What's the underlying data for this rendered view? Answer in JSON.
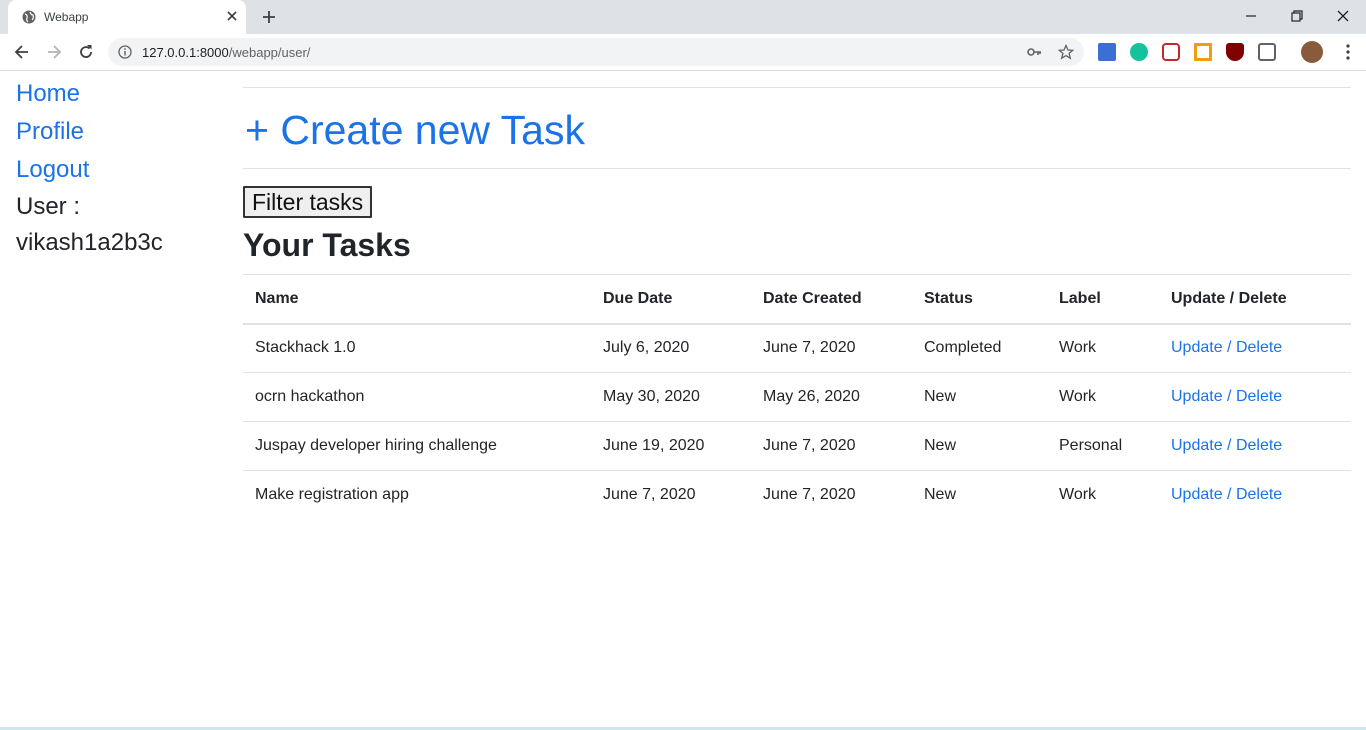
{
  "browser": {
    "tab_title": "Webapp",
    "url_host": "127.0.0.1:8000",
    "url_path": "/webapp/user/",
    "accent": "#1a73e8"
  },
  "sidebar": {
    "links": [
      {
        "label": "Home"
      },
      {
        "label": "Profile"
      },
      {
        "label": "Logout"
      }
    ],
    "user_label": "User :",
    "username": "vikash1a2b3c"
  },
  "main": {
    "create_label": "+ Create new Task",
    "filter_label": "Filter tasks",
    "section_title": "Your Tasks"
  },
  "table": {
    "headers": [
      "Name",
      "Due Date",
      "Date Created",
      "Status",
      "Label",
      "Update / Delete"
    ],
    "rows": [
      {
        "name": "Stackhack 1.0",
        "due": "July 6, 2020",
        "created": "June 7, 2020",
        "status": "Completed",
        "label": "Work",
        "update": "Update",
        "delete": "Delete"
      },
      {
        "name": "ocrn hackathon",
        "due": "May 30, 2020",
        "created": "May 26, 2020",
        "status": "New",
        "label": "Work",
        "update": "Update",
        "delete": "Delete"
      },
      {
        "name": "Juspay developer hiring challenge",
        "due": "June 19, 2020",
        "created": "June 7, 2020",
        "status": "New",
        "label": "Personal",
        "update": "Update",
        "delete": "Delete"
      },
      {
        "name": "Make registration app",
        "due": "June 7, 2020",
        "created": "June 7, 2020",
        "status": "New",
        "label": "Work",
        "update": "Update",
        "delete": "Delete"
      }
    ]
  }
}
